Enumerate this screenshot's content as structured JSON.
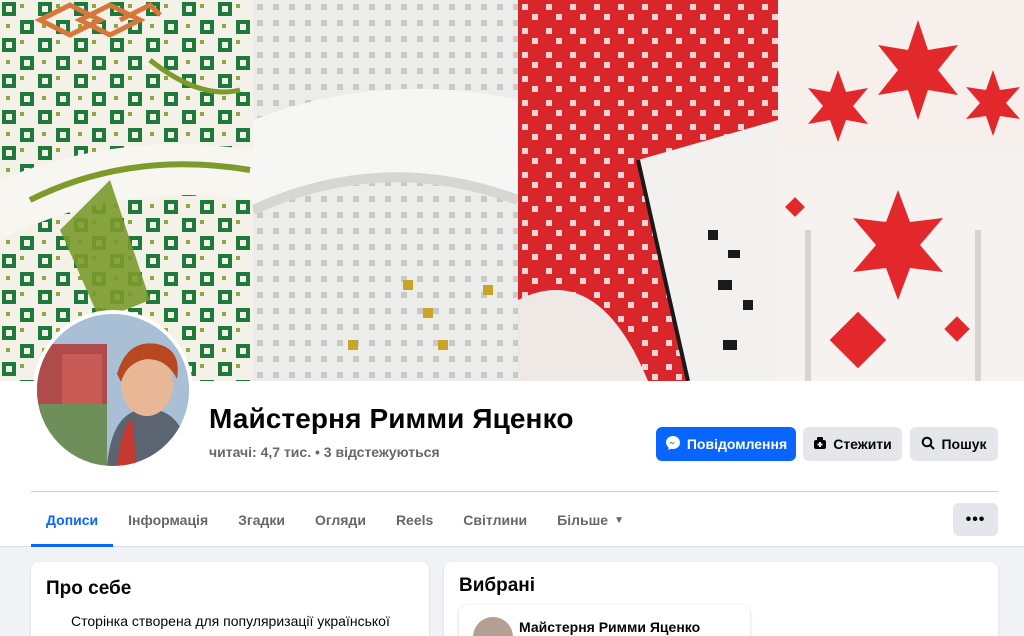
{
  "page": {
    "name": "Майстерня Римми Яценко",
    "followers": "читачі: 4,7 тис.",
    "separator": " • ",
    "following": "3 відстежуються"
  },
  "actions": {
    "message": "Повідомлення",
    "follow": "Стежити",
    "search": "Пошук"
  },
  "tabs": [
    {
      "label": "Дописи"
    },
    {
      "label": "Інформація"
    },
    {
      "label": "Згадки"
    },
    {
      "label": "Огляди"
    },
    {
      "label": "Reels"
    },
    {
      "label": "Світлини"
    },
    {
      "label": "Більше"
    }
  ],
  "about": {
    "title": "Про себе",
    "text": "Сторінка створена для популяризації української"
  },
  "featured": {
    "title": "Вибрані",
    "item_name": "Майстерня Римми Яценко"
  },
  "more_menu": "•••",
  "colors": {
    "accent": "#0866ff",
    "secondary_button": "#e4e6eb",
    "muted_text": "#65676b"
  },
  "icons": [
    "messenger-icon",
    "follow-icon",
    "search-icon",
    "caret-down-icon",
    "more-dots-icon"
  ]
}
